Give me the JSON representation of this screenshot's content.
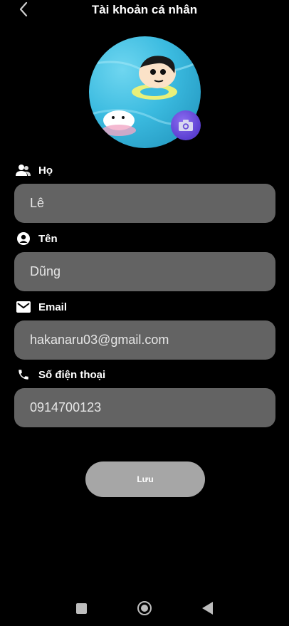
{
  "header": {
    "title": "Tài khoản cá nhân",
    "back_icon": "chevron-left-icon"
  },
  "avatar": {
    "camera_icon": "camera-icon"
  },
  "fields": {
    "last_name": {
      "label": "Họ",
      "value": "Lê",
      "icon": "users-icon"
    },
    "first_name": {
      "label": "Tên",
      "value": "Dũng",
      "icon": "user-circle-icon"
    },
    "email": {
      "label": "Email",
      "value": "hakanaru03@gmail.com",
      "icon": "mail-icon"
    },
    "phone": {
      "label": "Số điện thoại",
      "value": "0914700123",
      "icon": "phone-icon"
    }
  },
  "save_button": {
    "label": "Lưu"
  },
  "colors": {
    "background": "#000000",
    "input_bg": "#636363",
    "button_bg": "#a6a6a6",
    "camera_accent": "#5b3fd1"
  }
}
